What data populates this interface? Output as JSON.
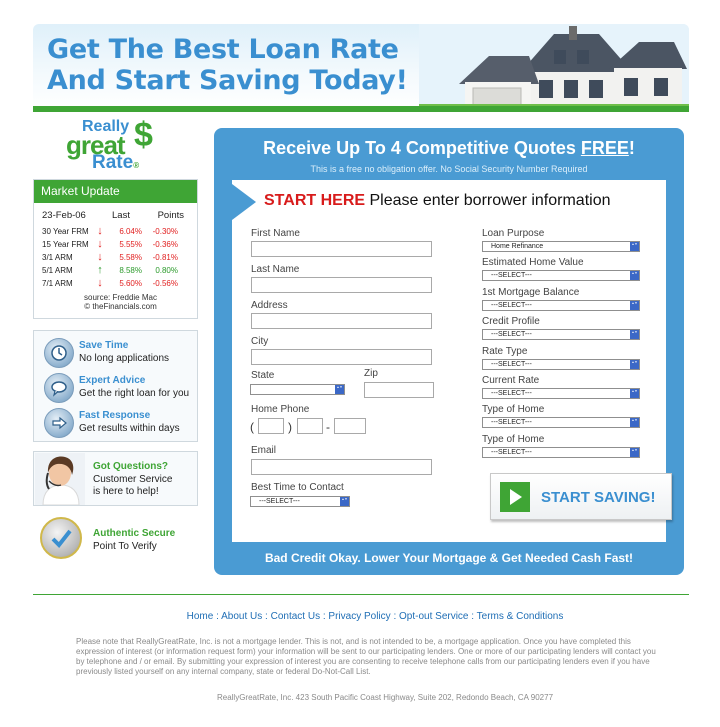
{
  "header": {
    "headline_line1": "Get The Best Loan Rate",
    "headline_line2": "And Start Saving Today!"
  },
  "logo": {
    "really": "Really",
    "great": "great",
    "rate": "Rate",
    "dollar": "$",
    "reg": "®"
  },
  "market": {
    "title": "Market Update",
    "date": "23-Feb-06",
    "col_last": "Last",
    "col_points": "Points",
    "rows": [
      {
        "name": "30 Year FRM",
        "dir": "down",
        "last": "6.04%",
        "points": "-0.30%"
      },
      {
        "name": "15 Year FRM",
        "dir": "down",
        "last": "5.55%",
        "points": "-0.36%"
      },
      {
        "name": "3/1 ARM",
        "dir": "down",
        "last": "5.58%",
        "points": "-0.81%"
      },
      {
        "name": "5/1 ARM",
        "dir": "up",
        "last": "8.58%",
        "points": "0.80%"
      },
      {
        "name": "7/1 ARM",
        "dir": "down",
        "last": "5.60%",
        "points": "-0.56%"
      }
    ],
    "source_line1": "source: Freddie Mac",
    "source_line2": "© theFinancials.com"
  },
  "features": [
    {
      "title": "Save Time",
      "desc": "No long applications",
      "icon": "clock-icon"
    },
    {
      "title": "Expert Advice",
      "desc": "Get the right loan for you",
      "icon": "chat-icon"
    },
    {
      "title": "Fast Response",
      "desc": "Get results within days",
      "icon": "arrow-right-icon"
    }
  ],
  "support": {
    "title": "Got Questions?",
    "line1": "Customer Service",
    "line2": "is here to help!"
  },
  "secure": {
    "title": "Authentic Secure",
    "desc": "Point To Verify"
  },
  "panel": {
    "title_prefix": "Receive Up To 4 Competitive Quotes ",
    "title_free": "FREE",
    "title_suffix": "!",
    "subtitle": "This is a free no obligation offer. No Social Security Number Required",
    "start_here": "START HERE",
    "start_rest": " Please enter borrower information",
    "footer": "Bad Credit Okay. Lower Your Mortgage & Get Needed Cash Fast!",
    "cta_label": "START SAVING!"
  },
  "form_left": {
    "first_name": "First Name",
    "last_name": "Last Name",
    "address": "Address",
    "city": "City",
    "state": "State",
    "zip": "Zip",
    "home_phone": "Home Phone",
    "phone_open": "(",
    "phone_close": ")",
    "phone_dash": "-",
    "email": "Email",
    "best_time": "Best Time to Contact",
    "best_time_value": "---SELECT---"
  },
  "form_right": [
    {
      "label": "Loan Purpose",
      "value": "Home Refinance"
    },
    {
      "label": "Estimated Home Value",
      "value": "---SELECT---"
    },
    {
      "label": "1st Mortgage Balance",
      "value": "---SELECT---"
    },
    {
      "label": "Credit Profile",
      "value": "---SELECT---"
    },
    {
      "label": "Rate Type",
      "value": "---SELECT---"
    },
    {
      "label": "Current Rate",
      "value": "---SELECT---"
    },
    {
      "label": "Type of Home",
      "value": "---SELECT---"
    },
    {
      "label": "Type of Home",
      "value": "---SELECT---"
    }
  ],
  "footer": {
    "links": [
      "Home",
      "About Us",
      "Contact Us",
      "Privacy Policy",
      "Opt-out Service",
      "Terms & Conditions"
    ],
    "sep": " : ",
    "disclaimer": "Please note that ReallyGreatRate, Inc. is not a mortgage lender. This is not, and is not intended to be, a mortgage application. Once you have completed this expression of interest (or information request form) your information will be sent to our participating lenders. One or more of our participating lenders will contact you by telephone and / or email. By submitting your expression of interest you are consenting to receive telephone calls from our participating lenders even if you have previously listed yourself on any internal company, state or federal Do-Not-Call List.",
    "address": "ReallyGreatRate, Inc. 423 South Pacific Coast Highway, Suite 202, Redondo Beach, CA 90277"
  },
  "colors": {
    "brand_blue": "#4a9bd3",
    "brand_green": "#3fa535",
    "alert_red": "#d81b1b"
  }
}
